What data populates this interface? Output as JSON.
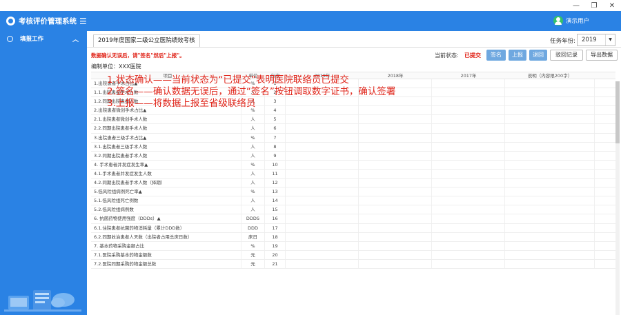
{
  "app": {
    "title": "考核评价管理系统",
    "menu_icon": "hamburger-icon"
  },
  "window": {
    "minimize": "—",
    "restore": "❐",
    "close": "✕"
  },
  "user": {
    "name": "演示用户",
    "icon": "user-avatar-icon"
  },
  "sidebar": {
    "items": [
      {
        "label": "填报工作",
        "icon": "monitor-icon"
      }
    ]
  },
  "tab": {
    "label": "2019年度国家二级公立医院绩效考核"
  },
  "year": {
    "label": "任务年份:",
    "value": "2019"
  },
  "notice": "数据确认无误后，请\"签名\"然后\"上报\"。",
  "org": "编制单位：XXX医院",
  "status": {
    "label": "当前状态:",
    "value": "已提交"
  },
  "buttons": {
    "sign": "签名",
    "report": "上报",
    "return": "退回",
    "return_log": "驳回记录",
    "export": "导出数据"
  },
  "table": {
    "headers": [
      "项目",
      "单位",
      "行次",
      "2019年",
      "2018年",
      "2017年",
      "说明（内容限200字）"
    ],
    "rows": [
      {
        "name": "1.出院患者手术占比▲",
        "unit": "%",
        "seq": "1"
      },
      {
        "name": "1.1.出院患者手术人数",
        "unit": "人",
        "seq": "2"
      },
      {
        "name": "1.2.同期出院患者人数",
        "unit": "人",
        "seq": "3"
      },
      {
        "name": "2.出院患者微创手术占比▲",
        "unit": "%",
        "seq": "4"
      },
      {
        "name": "2.1.出院患者微创手术人数",
        "unit": "人",
        "seq": "5"
      },
      {
        "name": "2.2.同期出院患者手术人数",
        "unit": "人",
        "seq": "6"
      },
      {
        "name": "3.出院患者三级手术占比▲",
        "unit": "%",
        "seq": "7"
      },
      {
        "name": "3.1.出院患者三级手术人数",
        "unit": "人",
        "seq": "8"
      },
      {
        "name": "3.2.同期出院患者手术人数",
        "unit": "人",
        "seq": "9"
      },
      {
        "name": "4. 手术患者并发症发生率▲",
        "unit": "%",
        "seq": "10"
      },
      {
        "name": "4.1.手术患者并发症发生人数",
        "unit": "人",
        "seq": "11"
      },
      {
        "name": "4.2.同期出院患者手术人数（择期）",
        "unit": "人",
        "seq": "12"
      },
      {
        "name": "5.低风险组病例死亡率▲",
        "unit": "%",
        "seq": "13"
      },
      {
        "name": "5.1.低风险组死亡例数",
        "unit": "人",
        "seq": "14"
      },
      {
        "name": "5.2.低风险组病例数",
        "unit": "人",
        "seq": "15"
      },
      {
        "name": "6. 抗菌药物使用强度（DDDs）▲",
        "unit": "DDDS",
        "seq": "16"
      },
      {
        "name": "6.1.住院患者抗菌药物消耗量（累计DDD数）",
        "unit": "DDD",
        "seq": "17"
      },
      {
        "name": "6.2.同期收治患者人天数（出院者占用总床日数）",
        "unit": "床日",
        "seq": "18"
      },
      {
        "name": "7. 基本药物采购金额占比",
        "unit": "%",
        "seq": "19"
      },
      {
        "name": "7.1.医院采购基本药物金额数",
        "unit": "元",
        "seq": "20"
      },
      {
        "name": "7.2.医院同期采购药物金额总数",
        "unit": "元",
        "seq": "21"
      }
    ]
  },
  "annotation": {
    "lines": [
      "1.状态确认——当前状态为“已提交”表明医院联络员已提交",
      "2.签名——确认数据无误后，通过“签名”按钮调取数字证书，确认签署",
      "3.上报——将数据上报至省级联络员"
    ]
  }
}
